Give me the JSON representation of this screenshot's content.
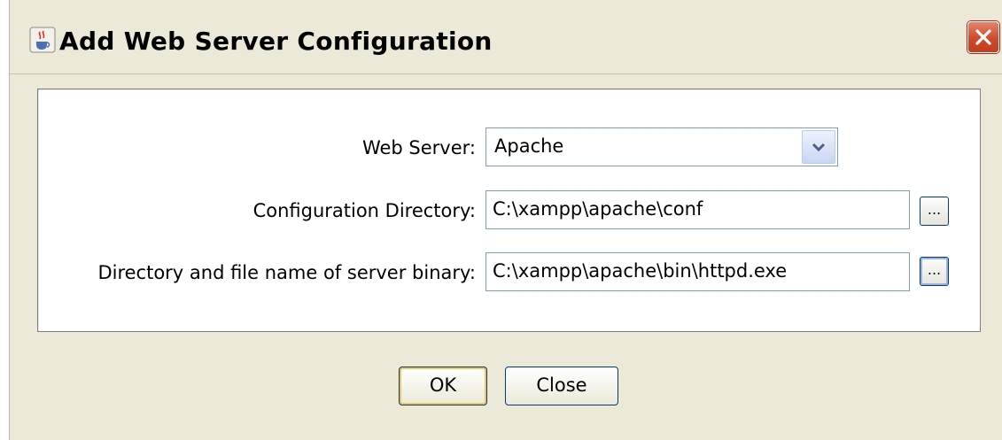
{
  "window": {
    "title": "Add Web Server Configuration",
    "app_icon": "java-cup-icon",
    "close_icon": "close-x-icon"
  },
  "form": {
    "web_server": {
      "label": "Web Server:",
      "selected": "Apache"
    },
    "config_dir": {
      "label": "Configuration Directory:",
      "value": "C:\\xampp\\apache\\conf",
      "browse_label": "..."
    },
    "server_binary": {
      "label": "Directory and file name of server binary:",
      "value": "C:\\xampp\\apache\\bin\\httpd.exe",
      "browse_label": "..."
    }
  },
  "buttons": {
    "ok": "OK",
    "close": "Close"
  },
  "colors": {
    "dialog_bg": "#ece9d8",
    "field_border": "#7f9db9",
    "close_button": "#cf4a2c",
    "default_button_highlight": "#f7c454"
  }
}
